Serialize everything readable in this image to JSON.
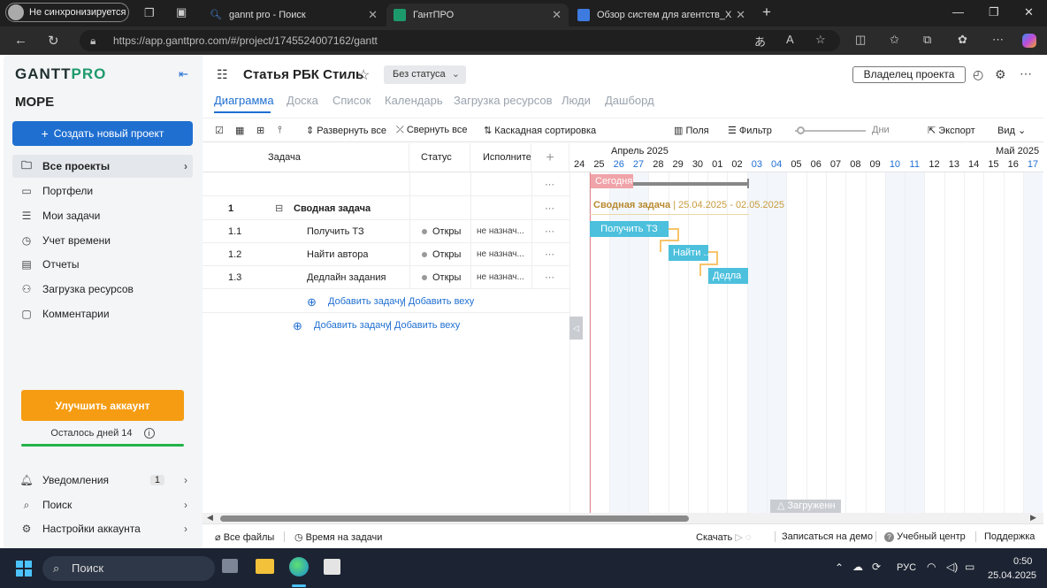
{
  "browser": {
    "profile": "Не синхронизируется",
    "tabs": [
      {
        "title": "gannt pro - Поиск"
      },
      {
        "title": "ГантПРО"
      },
      {
        "title": "Обзор систем для агентств_Хабр"
      }
    ],
    "url": "https://app.ganttpro.com/#/project/1745524007162/gantt"
  },
  "sidebar": {
    "logo_a": "GANTT",
    "logo_b": "PRO",
    "workspace": "МОРЕ",
    "create_button": "Создать новый проект",
    "items": [
      {
        "label": "Все проекты",
        "icon": "folder-icon"
      },
      {
        "label": "Портфели",
        "icon": "briefcase-icon"
      },
      {
        "label": "Мои задачи",
        "icon": "list-icon"
      },
      {
        "label": "Учет времени",
        "icon": "clock-icon"
      },
      {
        "label": "Отчеты",
        "icon": "chart-icon"
      },
      {
        "label": "Загрузка ресурсов",
        "icon": "resource-icon"
      },
      {
        "label": "Комментарии",
        "icon": "comment-icon"
      }
    ],
    "upgrade_button": "Улучшить аккаунт",
    "days_left": "Осталось дней 14",
    "bottom": [
      {
        "label": "Уведомления",
        "badge": "1"
      },
      {
        "label": "Поиск"
      },
      {
        "label": "Настройки аккаунта"
      }
    ]
  },
  "project": {
    "title": "Статья РБК Стиль",
    "status": "Без статуса",
    "owner_button": "Владелец проекта"
  },
  "view_tabs": [
    "Диаграмма",
    "Доска",
    "Список",
    "Календарь",
    "Загрузка ресурсов",
    "Люди",
    "Дашборд"
  ],
  "toolbar": {
    "expand_all": "Развернуть все",
    "collapse_all": "Свернуть все",
    "cascade_sort": "Каскадная сортировка",
    "fields": "Поля",
    "filter": "Фильтр",
    "zoom": "Дни",
    "export": "Экспорт",
    "view": "Вид"
  },
  "grid": {
    "headers": {
      "task": "Задача",
      "status": "Статус",
      "assignee": "Исполните"
    },
    "rows": [
      {
        "num": "1",
        "name": "Сводная задача",
        "status": "",
        "assignee": ""
      },
      {
        "num": "1.1",
        "name": "Получить ТЗ",
        "status": "Откры",
        "assignee": "не назнач..."
      },
      {
        "num": "1.2",
        "name": "Найти автора",
        "status": "Откры",
        "assignee": "не назнач..."
      },
      {
        "num": "1.3",
        "name": "Дедлайн задания",
        "status": "Откры",
        "assignee": "не назнач..."
      }
    ],
    "add_task": "Добавить задачу",
    "add_milestone": "Добавить веху"
  },
  "gantt": {
    "month_left": "Апрель 2025",
    "month_right": "Май 2025",
    "days": [
      "24",
      "25",
      "26",
      "27",
      "28",
      "29",
      "30",
      "01",
      "02",
      "03",
      "04",
      "05",
      "06",
      "07",
      "08",
      "09",
      "10",
      "11",
      "12",
      "13",
      "14",
      "15",
      "16",
      "17"
    ],
    "weekend_days": [
      "26",
      "27",
      "03",
      "04",
      "10",
      "11",
      "17"
    ],
    "today_label": "Сегодня",
    "summary_label": "Сводная задача",
    "summary_dates": "25.04.2025 - 02.05.2025",
    "bars": [
      {
        "label": "Получить ТЗ"
      },
      {
        "label": "Найти ..."
      },
      {
        "label": "Дедла"
      }
    ],
    "loaded_label": "Загруженн"
  },
  "statusbar": {
    "all_files": "Все файлы",
    "time_on_tasks": "Время на задачи",
    "download": "Скачать",
    "demo": "Записаться на демо",
    "learning": "Учебный центр",
    "support": "Поддержка"
  },
  "taskbar": {
    "search": "Поиск",
    "lang": "РУС",
    "time": "0:50",
    "date": "25.04.2025"
  },
  "colors": {
    "accent": "#1f6fd1",
    "brand_green": "#1d9a6c",
    "upgrade": "#f59c12",
    "task_bar": "#4cc0dd",
    "today": "#f0a3a8",
    "summary": "#c89b3c"
  }
}
